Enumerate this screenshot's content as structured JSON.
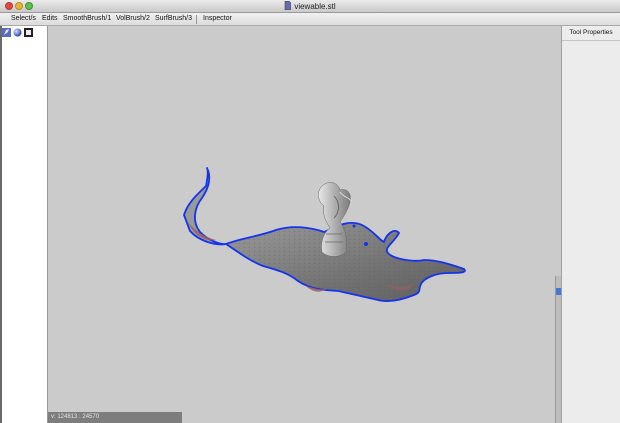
{
  "window": {
    "title": "viewable.stl"
  },
  "menu": {
    "items": [
      "Select/s",
      "Edits",
      "SmoothBrush/1",
      "VolBrush/2",
      "SurfBrush/3",
      "Inspector"
    ]
  },
  "toolbar": {
    "icons": [
      "brush-tool-icon",
      "sphere-icon",
      "stop-icon"
    ]
  },
  "right_panel": {
    "title": "Tool Properties"
  },
  "status": {
    "text": "v: 124813 : 24570"
  },
  "colors": {
    "viewport_bg": "#cbcbcb",
    "mesh": "#7c7c7c",
    "boundary": "#1433ee",
    "backface": "#9a6060"
  }
}
